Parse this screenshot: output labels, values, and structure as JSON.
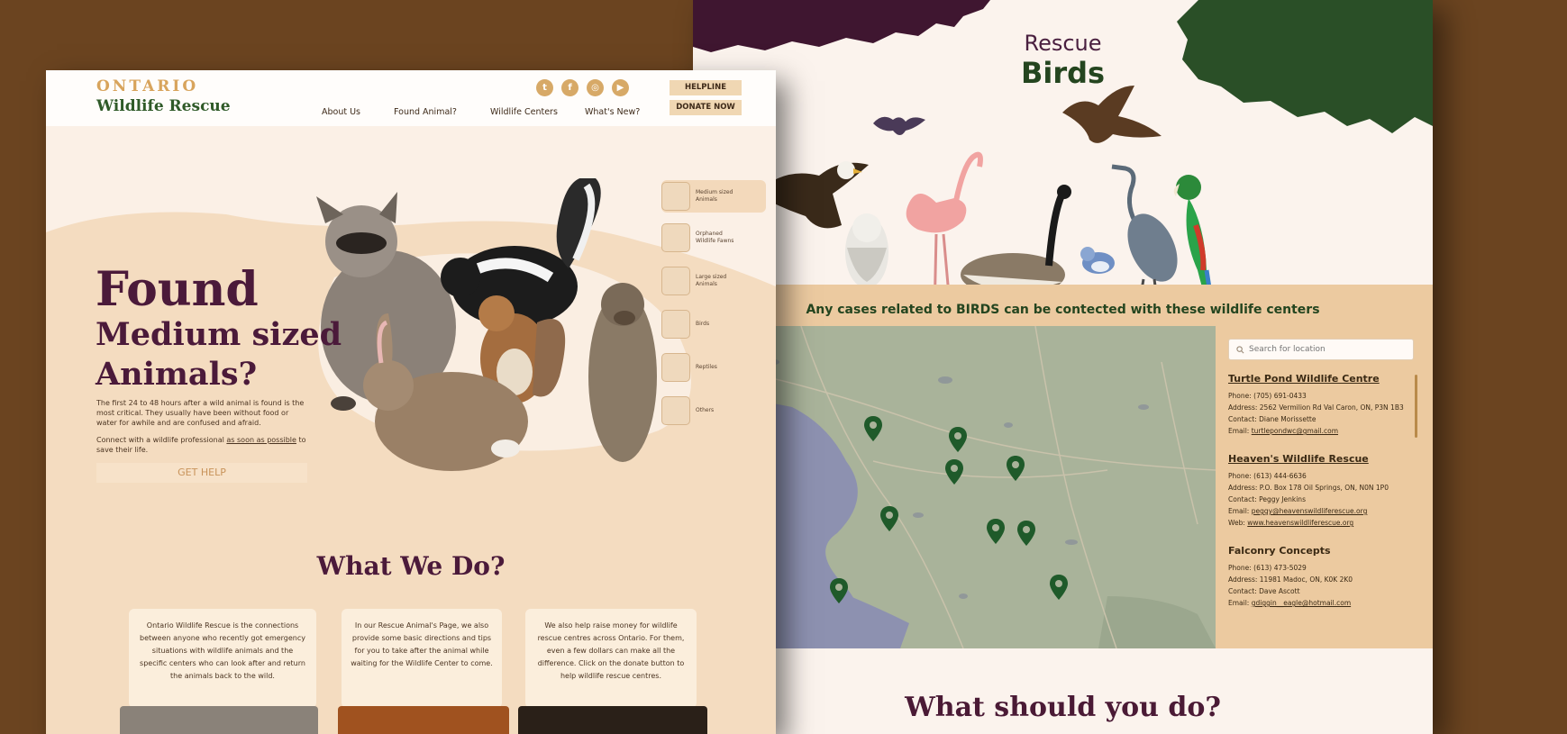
{
  "colors": {
    "background": "#6b4420",
    "plum": "#4b1a3a",
    "forest": "#24451f",
    "sand": "#eccaa0",
    "cream": "#fbf3ed"
  },
  "birds_page": {
    "pre_title": "Rescue",
    "title": "Birds",
    "caption": "Any cases related to BIRDS can be contected with these wildlife centers",
    "search_placeholder": "Search for location",
    "search_icon": "search-icon",
    "map_pin_icon": "map-pin-icon",
    "centers": [
      {
        "name": "Turtle Pond Wildlife Centre",
        "phone": "Phone: (705) 691-0433",
        "address": "Address: 2562 Vermilion Rd Val Caron, ON, P3N 1B3",
        "contact": "Contact: Diane Morissette",
        "email_label": "Email:",
        "email": "turtlepondwc@gmail.com"
      },
      {
        "name": "Heaven's Wildlife Rescue",
        "phone": "Phone: (613) 444-6636",
        "address": "Address: P.O. Box 178 Oil Springs, ON, N0N 1P0",
        "contact": "Contact: Peggy Jenkins",
        "email_label": "Email:",
        "email": "peggy@heavenswildliferescue.org",
        "web_label": "Web:",
        "web": "www.heavenswildliferescue.org"
      },
      {
        "name": "Falconry Concepts",
        "phone": "Phone: (613) 473-5029",
        "address": "Address: 11981 Madoc, ON, K0K 2K0",
        "contact": "Contact: Dave Ascott",
        "email_label": "Email:",
        "email": "gdiggin__eagle@hotmail.com"
      }
    ],
    "footer_title": "What should you do?"
  },
  "home_page": {
    "logo_top": "ONTARIO",
    "logo_bottom": "Wildlife Rescue",
    "nav": [
      "About Us",
      "Found Animal?",
      "Wildlife Centers",
      "What's New?"
    ],
    "social": [
      {
        "icon": "twitter-icon",
        "glyph": "t"
      },
      {
        "icon": "facebook-icon",
        "glyph": "f"
      },
      {
        "icon": "instagram-icon",
        "glyph": "◎"
      },
      {
        "icon": "youtube-icon",
        "glyph": "▶"
      }
    ],
    "helpline_label": "HELPLINE",
    "donate_label": "DONATE NOW",
    "hero_title": "Found",
    "hero_subtitle": "Medium sized Animals?",
    "hero_para1": "The first 24 to 48 hours after a wild animal is found is the most critical. They usually have been without food or water for awhile and are confused and afraid.",
    "hero_para2_pre": "Connect with a wildlife professional ",
    "hero_para2_link": "as soon as possible",
    "hero_para2_post": " to save their life.",
    "get_help_label": "GET HELP",
    "categories": [
      {
        "label": "Medium sized Animals",
        "active": true
      },
      {
        "label": "Orphaned Wildlife Fawns",
        "active": false
      },
      {
        "label": "Large sized Animals",
        "active": false
      },
      {
        "label": "Birds",
        "active": false
      },
      {
        "label": "Reptiles",
        "active": false
      },
      {
        "label": "Others",
        "active": false
      }
    ],
    "what_title": "What We Do?",
    "cards": [
      "Ontario Wildlife Rescue is the connections between anyone who recently got emergency situations with wildlife animals and the specific centers who can look after and return the animals back to the wild.",
      "In our Rescue Animal's Page, we also provide some basic directions and tips for you to take after the animal while waiting for the Wildlife Center to come.",
      "We also help raise money for wildlife rescue centres across Ontario. For them, even a few dollars can make all the difference. Click on the donate button to help wildlife rescue centres."
    ]
  }
}
